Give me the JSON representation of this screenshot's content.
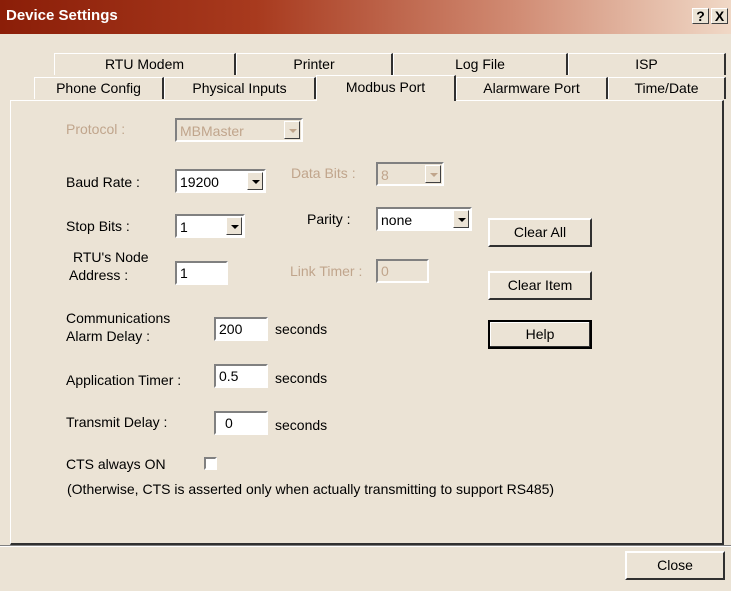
{
  "window": {
    "title": "Device Settings",
    "help_glyph": "?",
    "close_glyph": "X"
  },
  "tabs": {
    "row1": [
      "RTU Modem",
      "Printer",
      "Log File",
      "ISP"
    ],
    "row2": [
      "Phone Config",
      "Physical Inputs",
      "Modbus Port",
      "Alarmware Port",
      "Time/Date"
    ],
    "active": "Modbus Port"
  },
  "form": {
    "protocol_label": "Protocol :",
    "protocol_value": "MBMaster",
    "baud_label": "Baud Rate :",
    "baud_value": "19200",
    "databits_label": "Data Bits :",
    "databits_value": "8",
    "stopbits_label": "Stop Bits :",
    "stopbits_value": "1",
    "parity_label": "Parity :",
    "parity_value": "none",
    "node_label_1": "RTU's Node",
    "node_label_2": "Address :",
    "node_value": "1",
    "linktimer_label": "Link Timer :",
    "linktimer_value": "0",
    "comm_label_1": "Communications",
    "comm_label_2": "Alarm Delay :",
    "comm_value": "200",
    "comm_unit": "seconds",
    "app_label": "Application Timer :",
    "app_value": "0.5",
    "app_unit": "seconds",
    "tx_label": "Transmit Delay :",
    "tx_value": "0",
    "tx_unit": "seconds",
    "cts_label": "CTS always ON",
    "cts_checked": false,
    "cts_note": "(Otherwise, CTS is asserted only when actually transmitting to support RS485)"
  },
  "buttons": {
    "clear_all": "Clear All",
    "clear_item": "Clear Item",
    "help": "Help",
    "close": "Close"
  },
  "colors": {
    "dialog_bg": "#ebe3d5",
    "title_start": "#8b1e08",
    "disabled_text": "#c0a58c"
  }
}
